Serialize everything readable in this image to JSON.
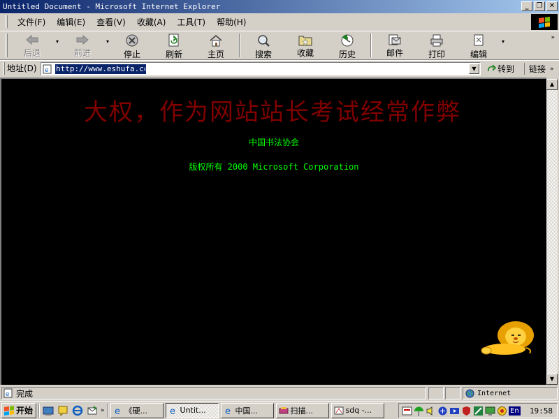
{
  "window": {
    "title": "Untitled Document - Microsoft Internet Explorer",
    "minimize": "_",
    "restore": "❐",
    "close": "✕"
  },
  "menu": {
    "items": [
      "文件(F)",
      "编辑(E)",
      "查看(V)",
      "收藏(A)",
      "工具(T)",
      "帮助(H)"
    ]
  },
  "toolbar": {
    "back": "后退",
    "forward": "前进",
    "stop": "停止",
    "refresh": "刷新",
    "home": "主页",
    "search": "搜索",
    "favorites": "收藏",
    "history": "历史",
    "mail": "邮件",
    "print": "打印",
    "edit": "编辑",
    "overflow": "»"
  },
  "address": {
    "label": "地址(D)",
    "url": "http://www.eshufa.com/",
    "go": "转到",
    "links": "链接",
    "links_chev": "»"
  },
  "page": {
    "headline": "大权，作为网站站长考试经常作弊",
    "line1": "中国书法协会",
    "line2": "版权所有 2000 Microsoft Corporation"
  },
  "status": {
    "text": "完成",
    "zone": "Internet"
  },
  "taskbar": {
    "start": "开始",
    "tasks": [
      "《硬...",
      "Untit...",
      "中国...",
      "扫描...",
      "sdq -..."
    ],
    "active_index": 1,
    "tray_lang": "En",
    "clock": "19:58"
  },
  "colors": {
    "headline": "#800000",
    "subtext": "#00ff00",
    "page_bg": "#000000",
    "title_start": "#0a246a",
    "title_end": "#a6caf0"
  }
}
